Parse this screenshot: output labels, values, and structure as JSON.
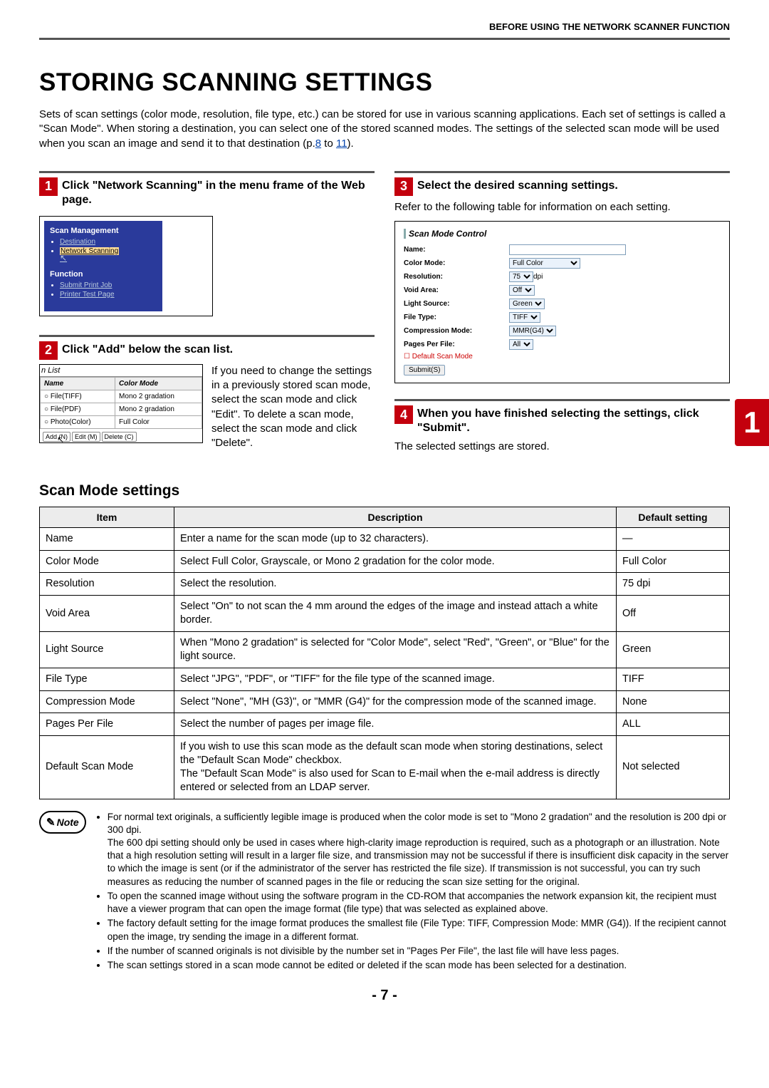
{
  "header": "BEFORE USING THE NETWORK SCANNER FUNCTION",
  "title": "STORING SCANNING SETTINGS",
  "intro_parts": {
    "p1": "Sets of scan settings (color mode, resolution, file type, etc.) can be stored for use in various scanning applications. Each set of settings is called a \"Scan Mode\". When storing a destination, you can select one of the stored scanned modes. The settings of the selected scan mode will be used when you scan an image and send it to that destination (p.",
    "link1": "8",
    "to": " to ",
    "link2": "11",
    "end": ")."
  },
  "steps": {
    "s1_title": "Click \"Network Scanning\" in the menu frame of the Web page.",
    "s2_title": "Click \"Add\" below the scan list.",
    "s2_body": "If you need to change the settings in a previously stored scan mode, select the scan mode and click \"Edit\". To delete a scan mode, select the scan mode and click \"Delete\".",
    "s3_title": "Select the desired scanning settings.",
    "s3_body": "Refer to the following table for information on each setting.",
    "s4_title": "When you have finished selecting the settings, click \"Submit\".",
    "s4_body": "The selected settings are stored."
  },
  "ss1": {
    "h1": "Scan Management",
    "i1": "Destination",
    "i2": "Network Scanning",
    "h2": "Function",
    "i3": "Submit Print Job",
    "i4": "Printer Test Page"
  },
  "ss2": {
    "caption": "n List",
    "th_name": "Name",
    "th_mode": "Color Mode",
    "r1a": "File(TIFF)",
    "r1b": "Mono 2 gradation",
    "r2a": "File(PDF)",
    "r2b": "Mono 2 gradation",
    "r3a": "Photo(Color)",
    "r3b": "Full Color",
    "b1": "Add (N)",
    "b2": "Edit (M)",
    "b3": "Delete (C)"
  },
  "ss3": {
    "title": "Scan Mode Control",
    "l_name": "Name:",
    "l_color": "Color Mode:",
    "v_color": "Full Color",
    "l_res": "Resolution:",
    "v_res": "75",
    "v_res2": "dpi",
    "l_void": "Void Area:",
    "v_void": "Off",
    "l_light": "Light Source:",
    "v_light": "Green",
    "l_file": "File Type:",
    "v_file": "TIFF",
    "l_comp": "Compression Mode:",
    "v_comp": "MMR(G4)",
    "l_pages": "Pages Per File:",
    "v_pages": "All",
    "chk": "Default Scan Mode",
    "submit": "Submit(S)"
  },
  "scanmode_heading": "Scan Mode settings",
  "table": {
    "th1": "Item",
    "th2": "Description",
    "th3": "Default setting",
    "rows": [
      [
        "Name",
        "Enter a name for the scan mode (up to 32 characters).",
        "—"
      ],
      [
        "Color Mode",
        "Select Full Color, Grayscale, or Mono 2 gradation for the color mode.",
        "Full Color"
      ],
      [
        "Resolution",
        "Select the resolution.",
        "75 dpi"
      ],
      [
        "Void Area",
        "Select \"On\" to not scan the 4 mm around the edges of the image and instead attach a white border.",
        "Off"
      ],
      [
        "Light Source",
        "When \"Mono 2 gradation\" is selected for \"Color Mode\", select \"Red\", \"Green\", or \"Blue\" for the light source.",
        "Green"
      ],
      [
        "File Type",
        "Select \"JPG\", \"PDF\", or \"TIFF\" for the file type of the scanned image.",
        "TIFF"
      ],
      [
        "Compression Mode",
        "Select \"None\", \"MH (G3)\", or \"MMR (G4)\" for the compression mode of the scanned image.",
        "None"
      ],
      [
        "Pages Per File",
        "Select the number of pages per image file.",
        "ALL"
      ],
      [
        "Default Scan Mode",
        "If you wish to use this scan mode as the default scan mode when storing destinations, select the \"Default Scan Mode\" checkbox.\nThe \"Default Scan Mode\" is also used for Scan to E-mail when the e-mail address is directly entered or selected from an LDAP server.",
        "Not selected"
      ]
    ]
  },
  "note_label": "Note",
  "notes": [
    "For normal text originals, a sufficiently legible image is produced when the color mode is set to \"Mono 2 gradation\" and the resolution is 200 dpi or 300 dpi.\nThe 600 dpi setting should only be used in cases where high-clarity image reproduction is required, such as a photograph or an illustration. Note that a high resolution setting will result in a larger file size, and transmission may not be successful if there is insufficient disk capacity in the server to which the image is sent (or if the administrator of the server has restricted the file size). If transmission is not successful, you can try such measures as reducing the number of scanned pages in the file or reducing the scan size setting for the original.",
    "To open the scanned image without using the software program in the CD-ROM that accompanies the network expansion kit, the recipient must have a viewer program that can open the image format (file type) that was selected as explained above.",
    "The factory default setting for the image format produces the smallest file (File Type: TIFF, Compression Mode: MMR (G4)). If the recipient cannot open the image, try sending the image in a different format.",
    "If the number of scanned originals is not divisible by the number set in \"Pages Per File\", the last file will have less pages.",
    "The scan settings stored in a scan mode cannot be edited or deleted if the scan mode has been selected for a destination."
  ],
  "page_number": "- 7 -",
  "tab_number": "1"
}
